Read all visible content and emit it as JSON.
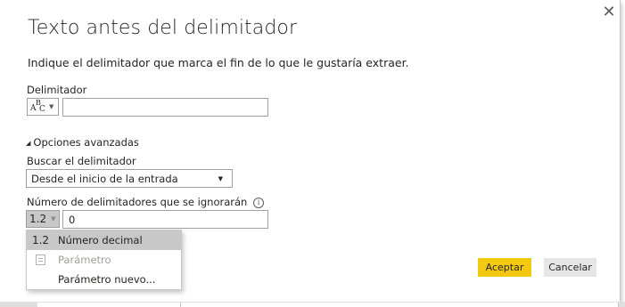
{
  "dialog": {
    "title": "Texto antes del delimitador",
    "description": "Indique el delimitador que marca el fin de lo que le gustaría extraer.",
    "close_glyph": "✕",
    "close_icon": "close-icon"
  },
  "delimiter": {
    "label": "Delimitador",
    "type_button_icon": "text-type-icon",
    "type_glyph_a": "A",
    "type_glyph_b": "B",
    "type_glyph_c": "C",
    "value": ""
  },
  "advanced": {
    "toggle_label": "Opciones avanzadas",
    "toggle_glyph": "◢",
    "scan_label": "Buscar el delimitador",
    "scan_value": "Desde el inicio de la entrada",
    "skip_label": "Número de delimitadores que se ignorarán",
    "info_glyph": "i",
    "skip_type_label": "1.2",
    "skip_value": "0"
  },
  "dropdown": {
    "items": [
      {
        "icon_text": "1.2",
        "label": "Número decimal",
        "selected": true,
        "disabled": false
      },
      {
        "icon": "parameter-icon",
        "label": "Parámetro",
        "selected": false,
        "disabled": true
      },
      {
        "icon_text": "",
        "label": "Parámetro nuevo...",
        "selected": false,
        "disabled": false
      }
    ]
  },
  "buttons": {
    "ok": "Aceptar",
    "cancel": "Cancelar"
  },
  "colors": {
    "accent": "#f2c811",
    "selected_bg": "#c8c8c8",
    "disabled_text": "#a19f9d"
  }
}
